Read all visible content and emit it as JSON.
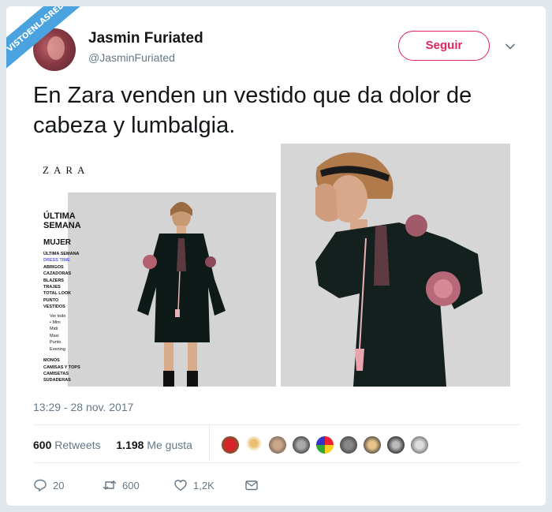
{
  "watermark": "VISTOENLASREDES",
  "author": {
    "name": "Jasmin Furiated",
    "handle": "@JasminFuriated"
  },
  "follow_label": "Seguir",
  "tweet_text": "En Zara venden un vestido que da dolor de cabeza y lumbalgia.",
  "image1": {
    "brand": "ZARA",
    "heading1": "ÚLTIMA",
    "heading2": "SEMANA",
    "section": "MUJER",
    "menu": [
      "ÚLTIMA SEMANA",
      "DRESS TIME",
      "ABRIGOS",
      "CAZADORAS",
      "BLAZERS",
      "TRAJES",
      "TOTAL LOOK",
      "PUNTO",
      "VESTIDOS"
    ],
    "submenu": [
      "Ver todo",
      "Mini",
      "Midi",
      "Maxi",
      "Punto",
      "Evening"
    ],
    "menu2": [
      "MONOS",
      "CAMISAS Y TOPS",
      "CAMISETAS",
      "SUDADERAS"
    ]
  },
  "timestamp": "13:29 - 28 nov. 2017",
  "stats": {
    "retweets_count": "600",
    "retweets_label": "Retweets",
    "likes_count": "1.198",
    "likes_label": "Me gusta"
  },
  "actions": {
    "replies": "20",
    "retweets": "600",
    "likes": "1,2K"
  },
  "colors": {
    "accent": "#e0245e",
    "secondary_text": "#657786",
    "ribbon": "#4aa3df"
  },
  "icons": [
    "chevron-down-icon",
    "reply-icon",
    "retweet-icon",
    "heart-icon",
    "mail-icon"
  ]
}
